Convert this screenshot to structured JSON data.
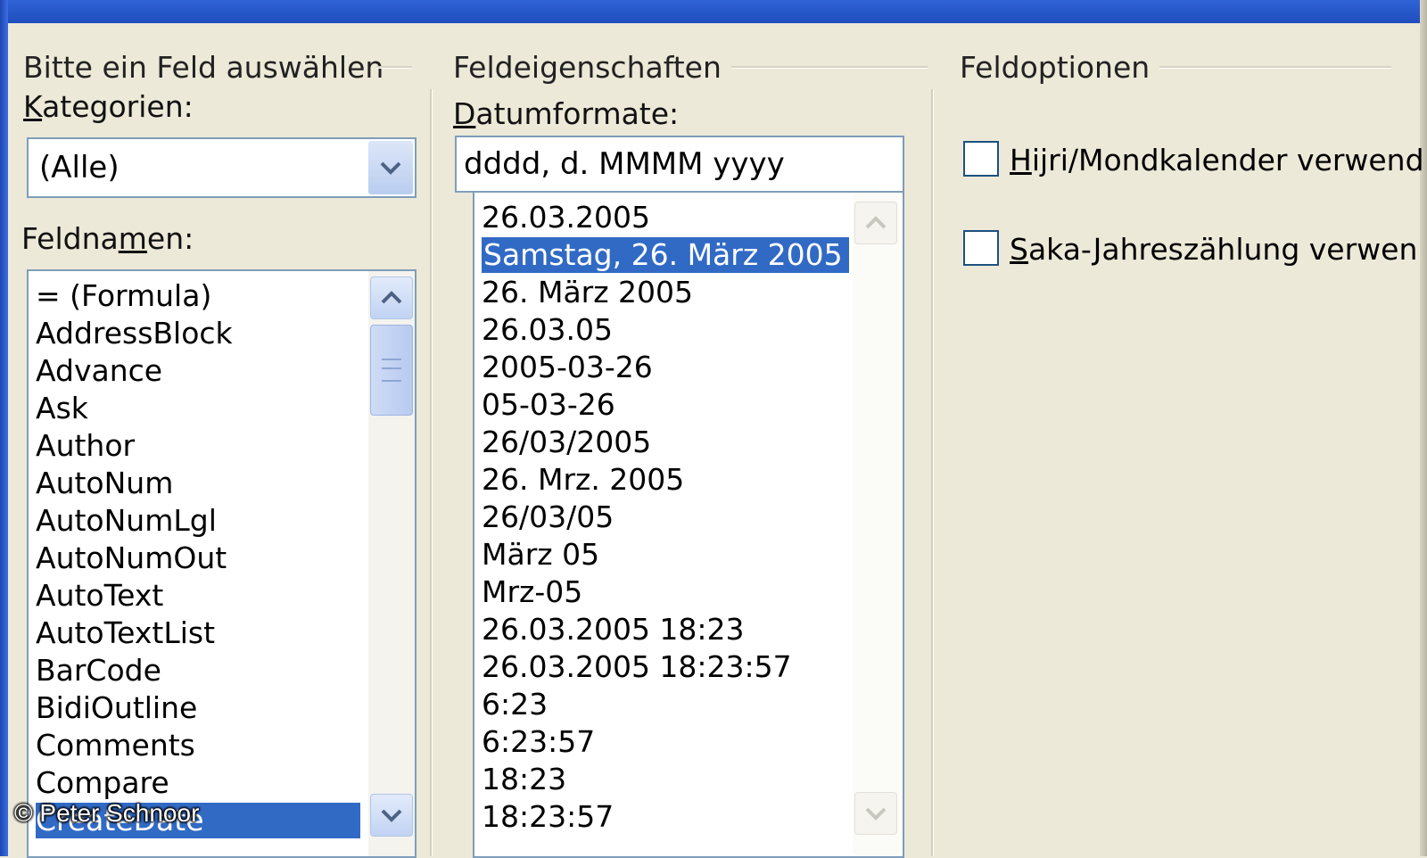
{
  "left_group": {
    "title": "Bitte ein Feld auswählen",
    "categories_label": "Kategorien:",
    "categories_value": "(Alle)",
    "fieldnames_label": "Feldnamen:",
    "fieldnames": [
      "= (Formula)",
      "AddressBlock",
      "Advance",
      "Ask",
      "Author",
      "AutoNum",
      "AutoNumLgl",
      "AutoNumOut",
      "AutoText",
      "AutoTextList",
      "BarCode",
      "BidiOutline",
      "Comments",
      "Compare",
      "CreateDate"
    ],
    "selected_fieldname": "CreateDate"
  },
  "middle_group": {
    "title": "Feldeigenschaften",
    "dateformats_label": "Datumformate:",
    "dateformat_value": "dddd, d. MMMM yyyy",
    "dateformats": [
      "26.03.2005",
      "Samstag, 26. März 2005",
      "26. März 2005",
      "26.03.05",
      "2005-03-26",
      "05-03-26",
      "26/03/2005",
      "26. Mrz. 2005",
      "26/03/05",
      "März 05",
      "Mrz-05",
      "26.03.2005 18:23",
      "26.03.2005 18:23:57",
      "6:23",
      "6:23:57",
      "18:23",
      "18:23:57"
    ],
    "selected_dateformat": "Samstag, 26. März 2005"
  },
  "right_group": {
    "title": "Feldoptionen",
    "options": [
      {
        "label": "Hijri/Mondkalender verwend",
        "checked": false
      },
      {
        "label": "Saka-Jahreszählung verwen",
        "checked": false
      }
    ]
  },
  "watermark": "© Peter Schnoor",
  "colors": {
    "selection": "#316ac5",
    "dialog_bg": "#ece9d8",
    "field_border": "#7f9db9"
  }
}
